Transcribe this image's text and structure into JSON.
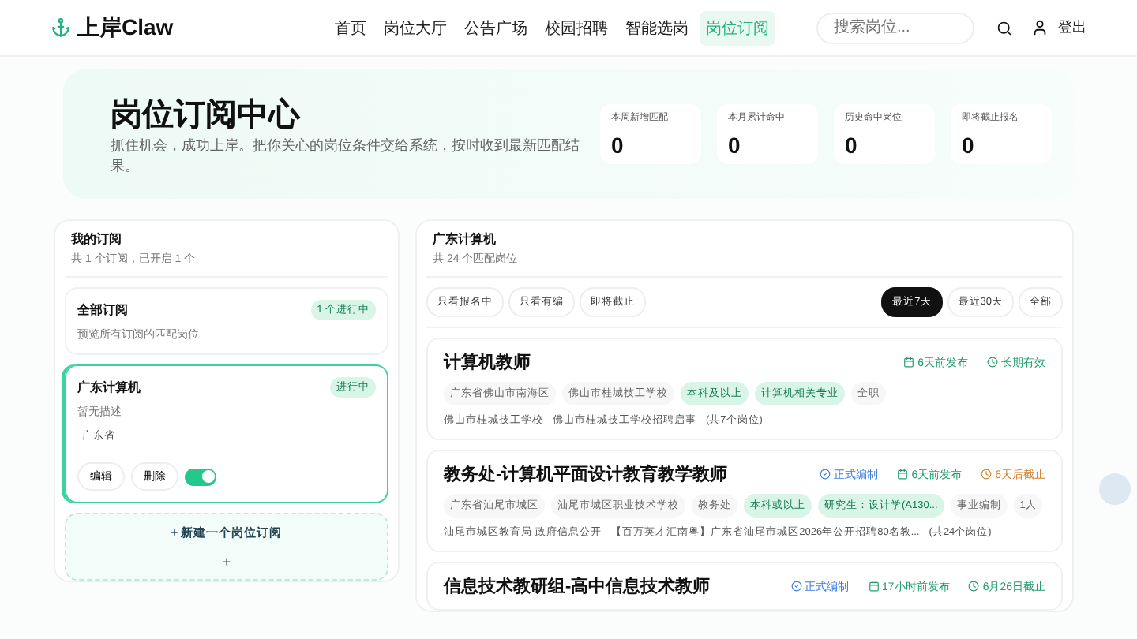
{
  "brand": {
    "name": "上岸Claw"
  },
  "nav": [
    {
      "label": "首页",
      "selected": false
    },
    {
      "label": "岗位大厅",
      "selected": false
    },
    {
      "label": "公告广场",
      "selected": false
    },
    {
      "label": "校园招聘",
      "selected": false
    },
    {
      "label": "智能选岗",
      "selected": false
    },
    {
      "label": "岗位订阅",
      "selected": true
    }
  ],
  "search": {
    "placeholder": "搜索岗位..."
  },
  "logout": "登出",
  "hero": {
    "title": "岗位订阅中心",
    "subtitle": "抓住机会，成功上岸。把你关心的岗位条件交给系统，按时收到最新匹配结果。",
    "stats": [
      {
        "label": "本周新增匹配",
        "value": "0"
      },
      {
        "label": "本月累计命中",
        "value": "0"
      },
      {
        "label": "历史命中岗位",
        "value": "0"
      },
      {
        "label": "即将截止报名",
        "value": "0"
      }
    ]
  },
  "subscriptions": {
    "title": "我的订阅",
    "summary": "共 1 个订阅，已开启 1 个",
    "items": [
      {
        "kind": "all",
        "name": "全部订阅",
        "description": "预览所有订阅的匹配岗位",
        "badge": "1 个进行中",
        "selected": false
      },
      {
        "kind": "custom",
        "name": "广东计算机",
        "description": "暂无描述",
        "region": "广东省",
        "badge": "进行中",
        "selected": true,
        "edit": "编辑",
        "delete": "删除",
        "on": true
      }
    ],
    "new_label": "+ 新建一个岗位订阅",
    "new_plus": "+"
  },
  "results": {
    "title": "广东计算机",
    "summary": "共 24 个匹配岗位",
    "filters": [
      {
        "label": "只看报名中",
        "selected": false
      },
      {
        "label": "只看有编",
        "selected": false
      },
      {
        "label": "即将截止",
        "selected": false
      }
    ],
    "ranges": [
      {
        "label": "最近7天",
        "selected": true
      },
      {
        "label": "最近30天",
        "selected": false
      },
      {
        "label": "全部",
        "selected": false
      }
    ],
    "jobs": [
      {
        "title": "计算机教师",
        "meta": [
          {
            "kind": "published",
            "text": "6天前发布",
            "color": "#1f9d6b"
          },
          {
            "kind": "deadline",
            "text": "长期有效",
            "color": "#1f9d6b"
          }
        ],
        "tags": [
          {
            "text": "广东省佛山市南海区",
            "highlight": false
          },
          {
            "text": "佛山市桂城技工学校",
            "highlight": false
          },
          {
            "text": "本科及以上",
            "highlight": true
          },
          {
            "text": "计算机相关专业",
            "highlight": true
          },
          {
            "text": "全职",
            "highlight": false
          }
        ],
        "source": "佛山市桂城技工学校",
        "notice": "佛山市桂城技工学校招聘启事",
        "count": "(共7个岗位)"
      },
      {
        "title": "教务处-计算机平面设计教育教学教师",
        "meta": [
          {
            "kind": "status",
            "text": "正式编制",
            "color": "#3b7de0"
          },
          {
            "kind": "published",
            "text": "6天前发布",
            "color": "#1f9d6b"
          },
          {
            "kind": "deadline",
            "text": "6天后截止",
            "color": "#d9822b"
          }
        ],
        "tags": [
          {
            "text": "广东省汕尾市城区",
            "highlight": false
          },
          {
            "text": "汕尾市城区职业技术学校",
            "highlight": false
          },
          {
            "text": "教务处",
            "highlight": false
          },
          {
            "text": "本科或以上",
            "highlight": true
          },
          {
            "text": "研究生：设计学(A130...",
            "highlight": true
          },
          {
            "text": "事业编制",
            "highlight": false
          },
          {
            "text": "1人",
            "highlight": false
          }
        ],
        "source": "汕尾市城区教育局-政府信息公开",
        "notice": "【百万英才汇南粤】广东省汕尾市城区2026年公开招聘80名教...",
        "count": "(共24个岗位)"
      },
      {
        "title": "信息技术教研组-高中信息技术教师",
        "meta": [
          {
            "kind": "status",
            "text": "正式编制",
            "color": "#3b7de0"
          },
          {
            "kind": "published",
            "text": "17小时前发布",
            "color": "#1f9d6b"
          },
          {
            "kind": "deadline",
            "text": "6月26日截止",
            "color": "#1f9d6b"
          }
        ]
      }
    ]
  }
}
